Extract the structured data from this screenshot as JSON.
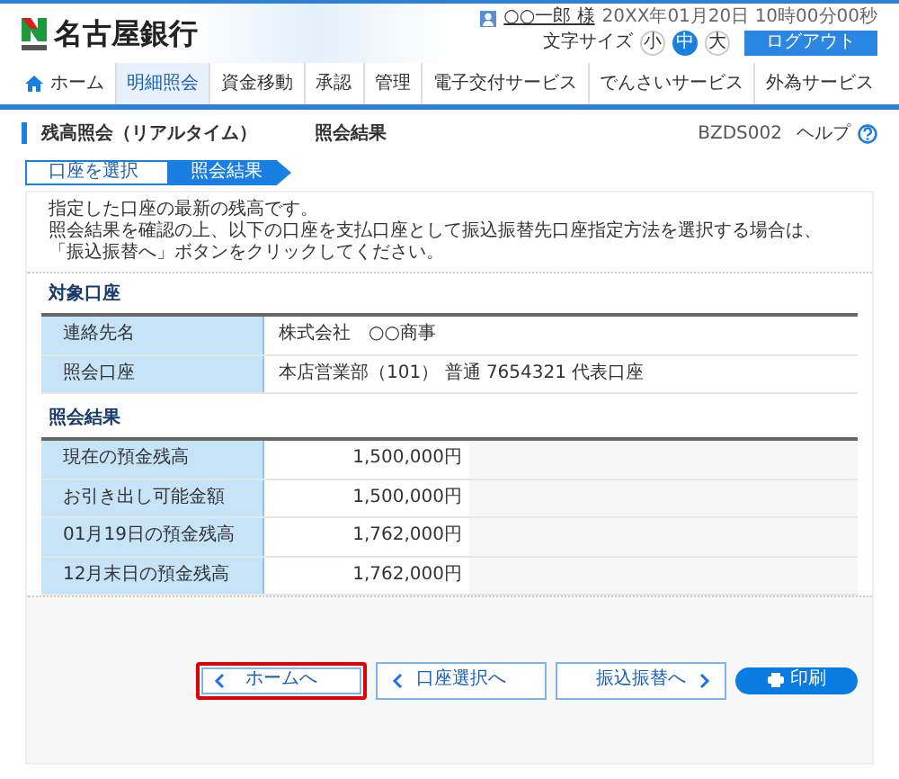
{
  "header": {
    "bank_name": "名古屋銀行",
    "user": "○○一郎 様",
    "datetime": "20XX年01月20日 10時00分00秒",
    "font_size_label": "文字サイズ",
    "font_sizes": [
      {
        "label": "小",
        "selected": false
      },
      {
        "label": "中",
        "selected": true
      },
      {
        "label": "大",
        "selected": false
      }
    ],
    "logout": "ログアウト"
  },
  "nav": [
    {
      "label": "ホーム",
      "kind": "home",
      "selected": false
    },
    {
      "label": "明細照会",
      "kind": "text",
      "selected": true
    },
    {
      "label": "資金移動",
      "kind": "text",
      "selected": false
    },
    {
      "label": "承認",
      "kind": "text",
      "selected": false
    },
    {
      "label": "管理",
      "kind": "text",
      "selected": false
    },
    {
      "label": "電子交付サービス",
      "kind": "text",
      "selected": false
    },
    {
      "label": "でんさいサービス",
      "kind": "text",
      "selected": false
    },
    {
      "label": "外為サービス",
      "kind": "text",
      "selected": false
    }
  ],
  "page_title": {
    "title": "残高照会（リアルタイム）",
    "subtitle": "照会結果",
    "screen_id": "BZDS002",
    "help": "ヘルプ"
  },
  "steps": [
    {
      "label": "口座を選択",
      "selected": false
    },
    {
      "label": "照会結果",
      "selected": true
    }
  ],
  "instructions": [
    "指定した口座の最新の残高です。",
    "照会結果を確認の上、以下の口座を支払口座として振込振替先口座指定方法を選択する場合は、「振込振替へ」ボタンをクリックしてください。"
  ],
  "account_section": {
    "heading": "対象口座",
    "rows": [
      {
        "label": "連絡先名",
        "value": "株式会社　○○商事"
      },
      {
        "label": "照会口座",
        "value": "本店営業部（101） 普通 7654321 代表口座"
      }
    ]
  },
  "result_section": {
    "heading": "照会結果",
    "rows": [
      {
        "label": "現在の預金残高",
        "value": "1,500,000円"
      },
      {
        "label": "お引き出し可能金額",
        "value": "1,500,000円"
      },
      {
        "label": "01月19日の預金残高",
        "value": "1,762,000円"
      },
      {
        "label": "12月末日の預金残高",
        "value": "1,762,000円"
      }
    ]
  },
  "buttons": [
    {
      "label": "ホームへ",
      "kind": "back",
      "highlighted": true
    },
    {
      "label": "口座選択へ",
      "kind": "back",
      "highlighted": false
    },
    {
      "label": "振込振替へ",
      "kind": "forward",
      "highlighted": false
    },
    {
      "label": "印刷",
      "kind": "print",
      "highlighted": false
    }
  ]
}
